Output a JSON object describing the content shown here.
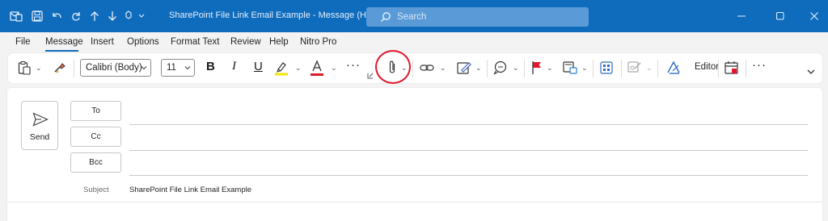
{
  "window": {
    "title": "SharePoint File Link Email Example  -  Message (HT...",
    "search_placeholder": "Search",
    "title_icons": [
      "outlook-message-icon",
      "save-icon",
      "undo-icon",
      "redo-icon",
      "up-arrow-icon",
      "down-arrow-icon",
      "customize-toolbar-icon"
    ],
    "window_buttons": [
      "minimize-icon",
      "maximize-icon",
      "close-icon"
    ]
  },
  "menu": {
    "items": [
      "File",
      "Message",
      "Insert",
      "Options",
      "Format Text",
      "Review",
      "Help",
      "Nitro Pro"
    ],
    "active": "Message"
  },
  "ribbon": {
    "font_name": "Calibri (Body)",
    "font_size": "11",
    "bold": "B",
    "italic": "I",
    "underline": "U",
    "more": "···",
    "editor_label": "Editor",
    "highlight_color": "#f5e600",
    "font_color": "#e0192c",
    "annotation_color": "#e0192c",
    "icons": [
      "paste-icon",
      "format-painter-icon",
      "attach-file-icon",
      "link-icon",
      "signature-icon",
      "sensitivity-icon",
      "flag-icon",
      "categorize-icon",
      "apps-icon",
      "protect-icon",
      "editor-icon",
      "scheduling-icon",
      "ribbon-collapse-icon"
    ]
  },
  "compose": {
    "send_label": "Send",
    "to_label": "To",
    "cc_label": "Cc",
    "bcc_label": "Bcc",
    "subject_label": "Subject",
    "subject_value": "SharePoint File Link Email Example"
  },
  "colors": {
    "titlebar": "#0f6cbd",
    "accent": "#0f6cbd"
  }
}
